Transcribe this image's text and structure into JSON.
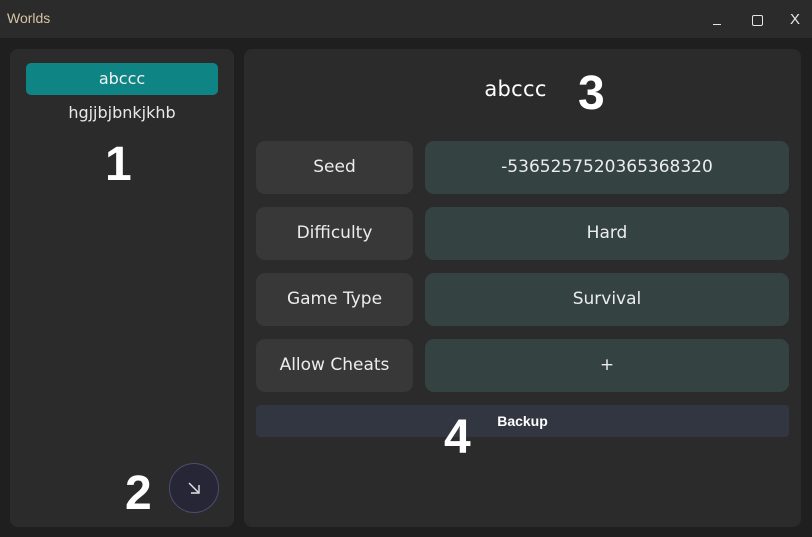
{
  "window": {
    "title": "Worlds",
    "close_label": "X"
  },
  "sidebar": {
    "worlds": [
      {
        "name": "abccc",
        "selected": true
      },
      {
        "name": "hgjjbjbnkjkhb",
        "selected": false
      }
    ],
    "open_button_icon": "arrow-down-right-icon"
  },
  "detail": {
    "world_name": "abccc",
    "properties": [
      {
        "label": "Seed",
        "value": "-5365257520365368320"
      },
      {
        "label": "Difficulty",
        "value": "Hard"
      },
      {
        "label": "Game Type",
        "value": "Survival"
      },
      {
        "label": "Allow Cheats",
        "value": "+"
      }
    ],
    "backup_label": "Backup"
  },
  "annotations": {
    "marker_1": "1",
    "marker_2": "2",
    "marker_3": "3",
    "marker_4": "4"
  },
  "colors": {
    "selected_item": "#0e8584",
    "value_box": "#344242",
    "label_box": "#383838",
    "panel": "#2b2b2b"
  }
}
